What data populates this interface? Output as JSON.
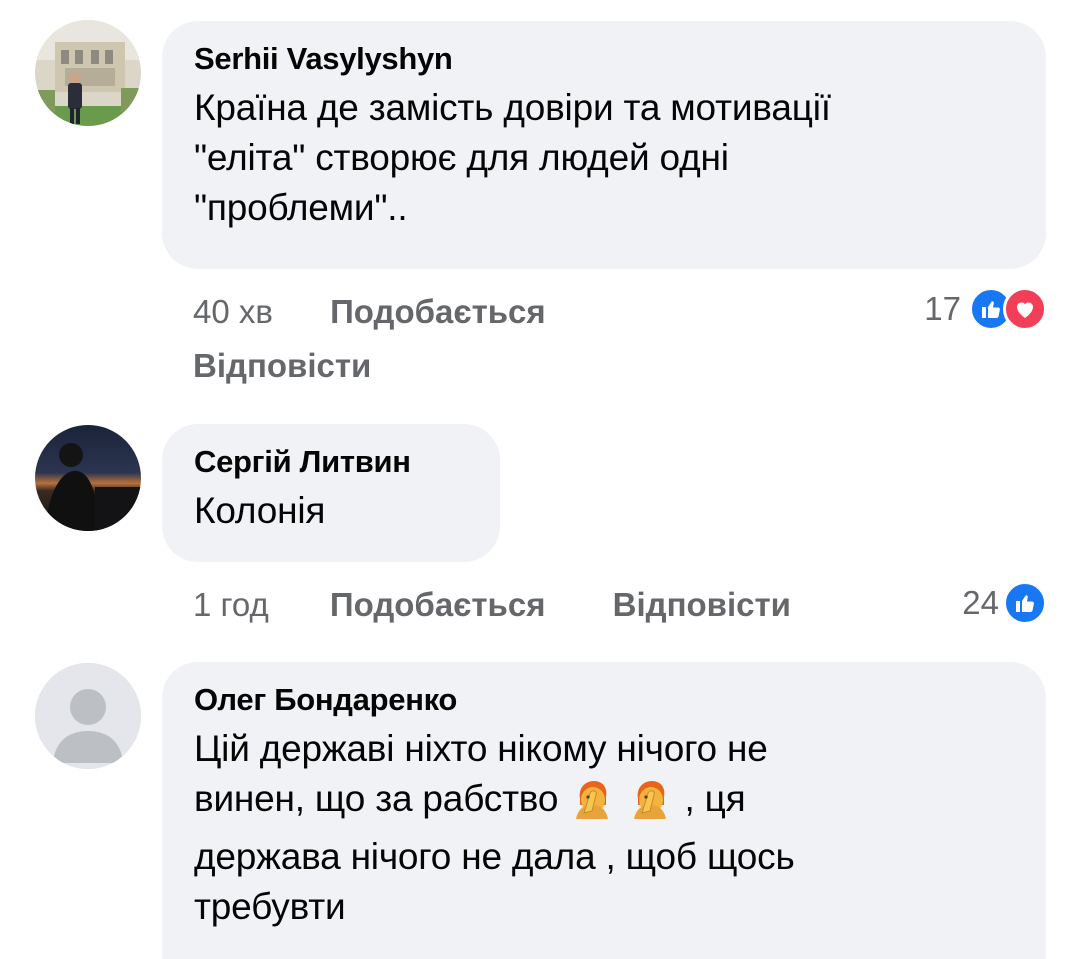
{
  "comments": [
    {
      "author": "Serhii Vasylyshyn",
      "lines": [
        "Країна де замість довіри та мотивації",
        "\"еліта\" створює для людей одні",
        "\"проблеми\".."
      ],
      "time": "40 хв",
      "like_label": "Подобається",
      "reply_label": "Відповісти",
      "reaction_count": "17",
      "reaction_icons": [
        "like-icon",
        "love-icon"
      ]
    },
    {
      "author": "Сергій Литвин",
      "lines": [
        "Колонія"
      ],
      "time": "1 год",
      "like_label": "Подобається",
      "reply_label": "Відповісти",
      "reaction_count": "24",
      "reaction_icons": [
        "like-icon"
      ]
    },
    {
      "author": "Олег Бондаренко",
      "lines": [
        "Цій державі ніхто нікому нічого не",
        "винен, що за рабство",
        ", ця",
        "держава нічого не дала , щоб щось",
        "требувти"
      ],
      "emojis": [
        "face-palm-emoji",
        "face-palm-emoji"
      ]
    }
  ],
  "colors": {
    "bubble": "#f0f2f5",
    "meta_text": "#65676b",
    "like_blue": "#1877f2",
    "love_red": "#f33e58"
  }
}
